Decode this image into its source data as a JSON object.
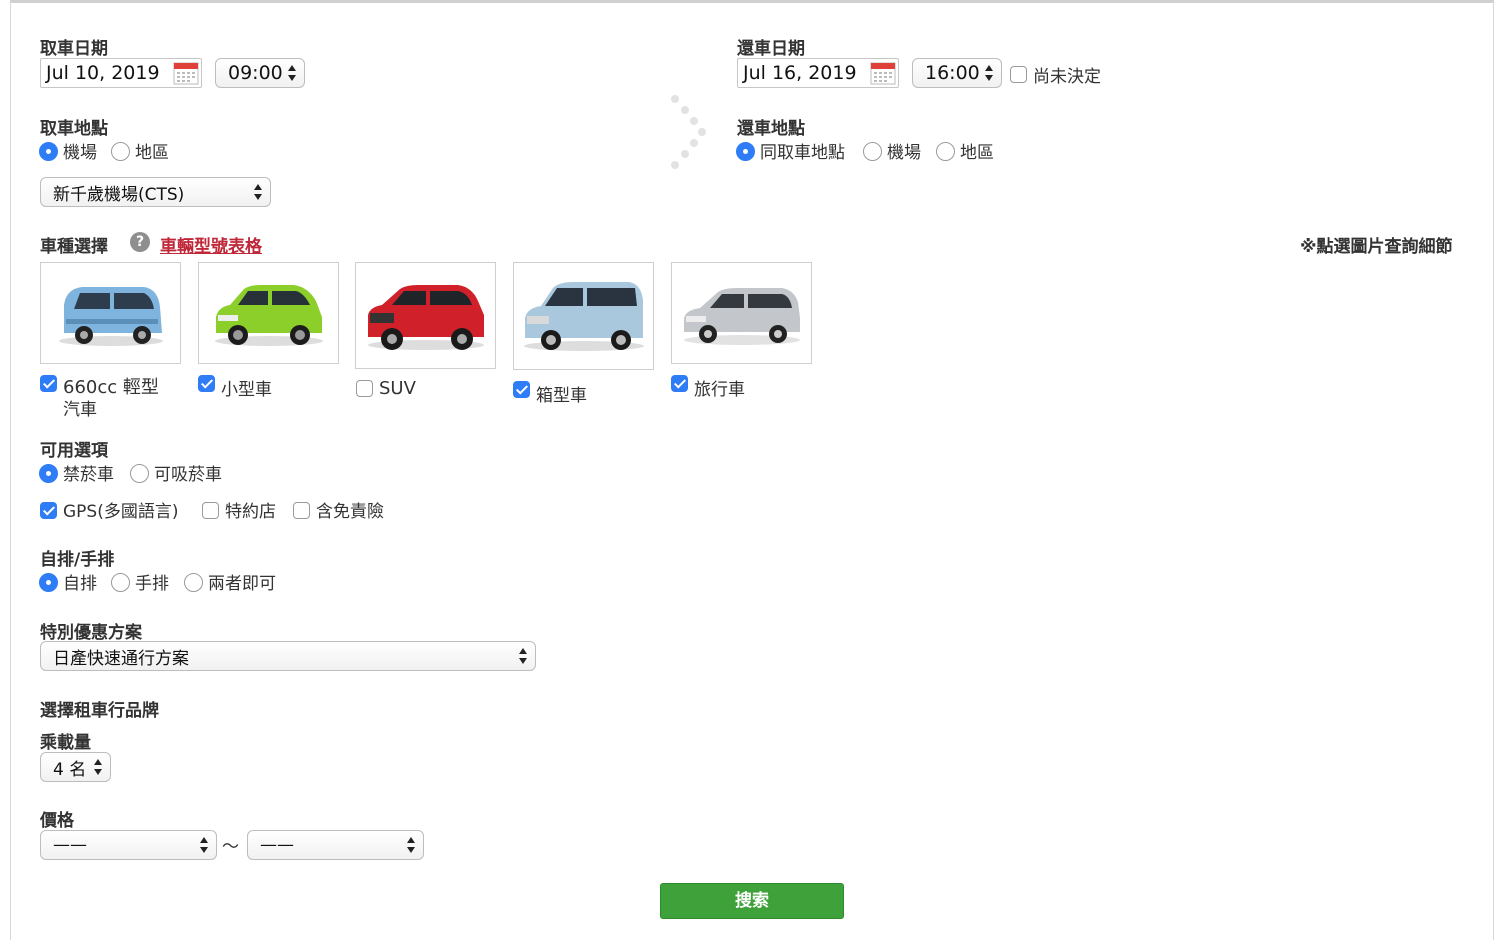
{
  "pickup": {
    "date_label": "取車日期",
    "date": "Jul 10, 2019",
    "time": "09:00",
    "location_label": "取車地點",
    "location_options": [
      "機場",
      "地區"
    ],
    "location_selected": "機場",
    "airport": "新千歲機場(CTS)"
  },
  "return": {
    "date_label": "還車日期",
    "date": "Jul 16, 2019",
    "time": "16:00",
    "undecided_label": "尚未決定",
    "undecided_checked": false,
    "location_label": "還車地點",
    "location_options": [
      "同取車地點",
      "機場",
      "地區"
    ],
    "location_selected": "同取車地點"
  },
  "car_types": {
    "label": "車種選擇",
    "help_icon": "question-circle-icon",
    "link": "車輛型號表格",
    "note": "※點選圖片查詢細節",
    "items": [
      {
        "line1": "660cc 輕型",
        "line2": "汽車",
        "checked": true,
        "color": "#7fb4de"
      },
      {
        "line1": "小型車",
        "line2": "",
        "checked": true,
        "color": "#8ccf2a"
      },
      {
        "line1": "SUV",
        "line2": "",
        "checked": false,
        "color": "#d0212b"
      },
      {
        "line1": "箱型車",
        "line2": "",
        "checked": true,
        "color": "#a9c8de"
      },
      {
        "line1": "旅行車",
        "line2": "",
        "checked": true,
        "color": "#c3c7cc"
      }
    ]
  },
  "options": {
    "label": "可用選項",
    "smoking": [
      {
        "label": "禁菸車",
        "selected": true
      },
      {
        "label": "可吸菸車",
        "selected": false
      }
    ],
    "extras": [
      {
        "label": "GPS(多國語言)",
        "checked": true
      },
      {
        "label": "特約店",
        "checked": false
      },
      {
        "label": "含免責險",
        "checked": false
      }
    ]
  },
  "transmission": {
    "label": "自排/手排",
    "choices": [
      {
        "label": "自排",
        "selected": true
      },
      {
        "label": "手排",
        "selected": false
      },
      {
        "label": "兩者即可",
        "selected": false
      }
    ]
  },
  "promo": {
    "label": "特別優惠方案",
    "value": "日產快速通行方案"
  },
  "brand": {
    "label": "選擇租車行品牌"
  },
  "capacity": {
    "label": "乘載量",
    "value": "4 名"
  },
  "price": {
    "label": "價格",
    "min": "——",
    "sep": "〜",
    "max": "——"
  },
  "search_button": "搜索",
  "colors": {
    "accent": "#2e7cf6",
    "button": "#3fa13a",
    "link": "#c0283a"
  }
}
